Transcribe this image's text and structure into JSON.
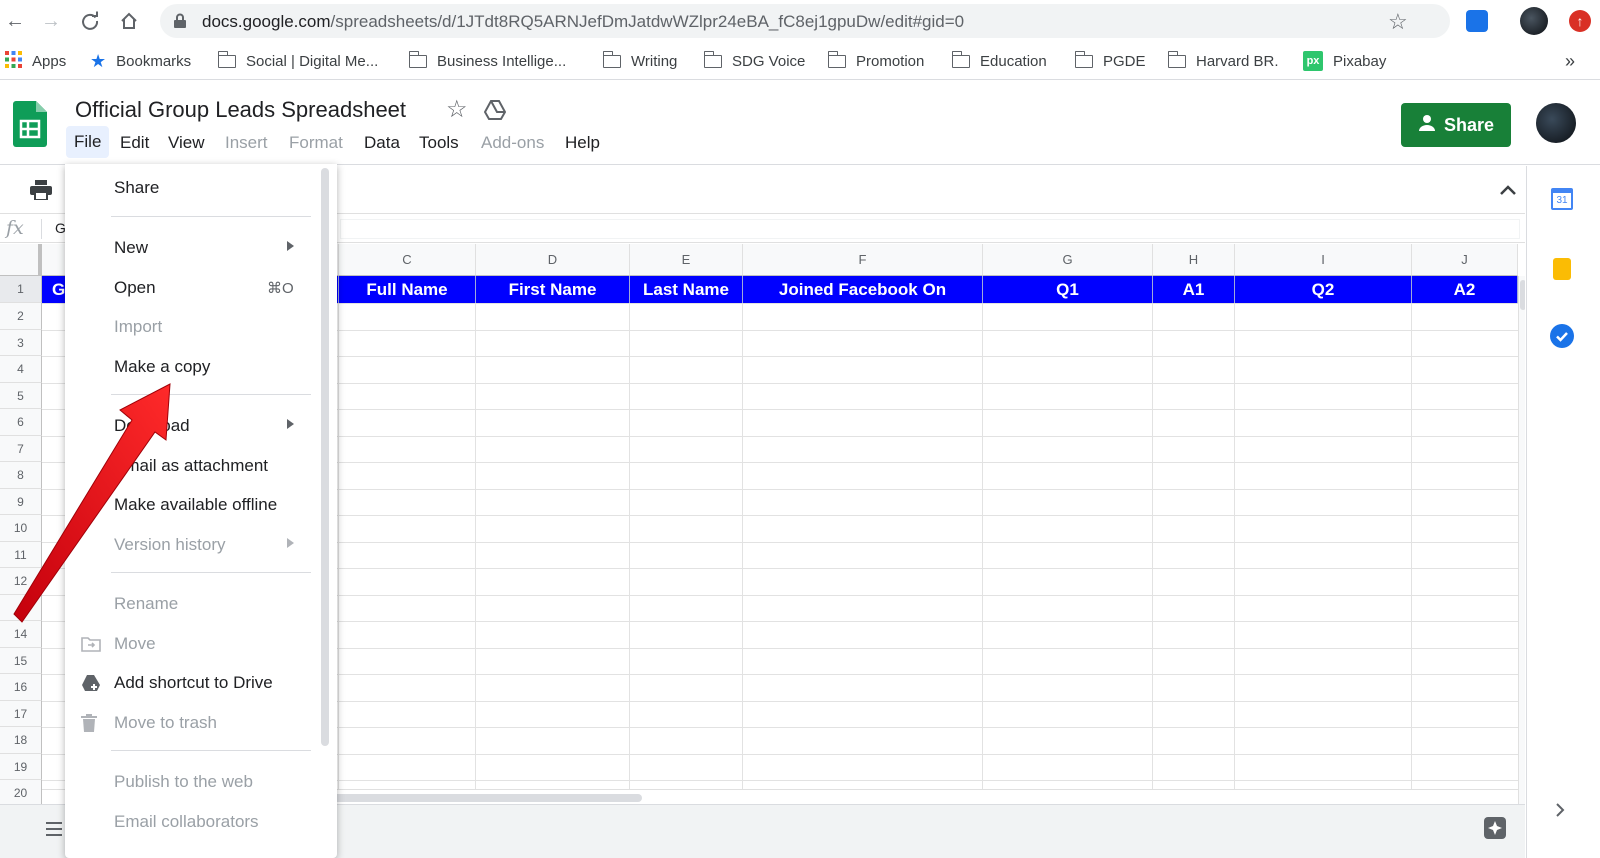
{
  "browser": {
    "url_host": "docs.google.com",
    "url_path": "/spreadsheets/d/1JTdt8RQ5ARNJefDmJatdwWZlpr24eBA_fC8ej1gpuDw/edit#gid=0",
    "bookmarks": [
      "Apps",
      "Bookmarks",
      "Social | Digital Me...",
      "Business Intellige...",
      "Writing",
      "SDG Voice",
      "Promotion",
      "Education",
      "PGDE",
      "Harvard BR.",
      "Pixabay"
    ],
    "more": "»"
  },
  "sheets": {
    "title": "Official Group Leads Spreadsheet",
    "menu": [
      "File",
      "Edit",
      "View",
      "Insert",
      "Format",
      "Data",
      "Tools",
      "Add-ons",
      "Help"
    ],
    "share_label": "Share",
    "formula_icon": "fx",
    "formula_value": "G"
  },
  "grid": {
    "columns": [
      "C",
      "D",
      "E",
      "F",
      "G",
      "H",
      "I",
      "J"
    ],
    "header_row": [
      "Full Name",
      "First Name",
      "Last Name",
      "Joined Facebook On",
      "Q1",
      "A1",
      "Q2",
      "A2"
    ],
    "a1_value": "G",
    "rows": [
      "1",
      "2",
      "3",
      "4",
      "5",
      "6",
      "7",
      "8",
      "9",
      "10",
      "11",
      "12",
      "14",
      "15",
      "16",
      "17",
      "18",
      "19",
      "20"
    ]
  },
  "file_menu": {
    "items": [
      {
        "label": "Share"
      },
      {
        "label": "New"
      },
      {
        "label": "Open",
        "shortcut": "⌘O"
      },
      {
        "label": "Import"
      },
      {
        "label": "Make a copy"
      },
      {
        "label": "Download"
      },
      {
        "label": "Email as attachment"
      },
      {
        "label": "Make available offline"
      },
      {
        "label": "Version history"
      },
      {
        "label": "Rename"
      },
      {
        "label": "Move"
      },
      {
        "label": "Add shortcut to Drive"
      },
      {
        "label": "Move to trash"
      },
      {
        "label": "Publish to the web"
      },
      {
        "label": "Email collaborators"
      }
    ]
  },
  "side_panel": {
    "calendar_day": "31"
  },
  "colors": {
    "header_fill": "#0000ff",
    "share_green": "#188038",
    "annotation_arrow": "#e8101a"
  }
}
